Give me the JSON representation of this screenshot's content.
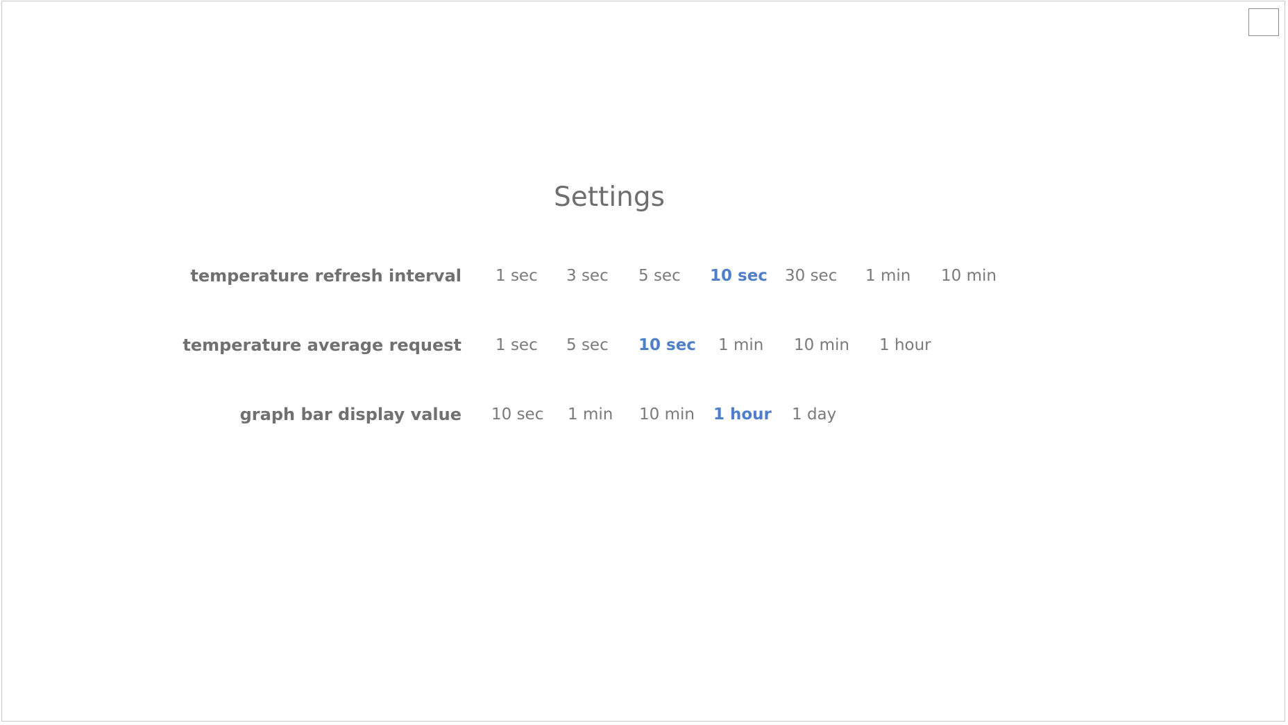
{
  "page": {
    "title": "Settings"
  },
  "colors": {
    "text_muted": "#7a7a7a",
    "label": "#707070",
    "selected": "#4f7fc9"
  },
  "settings": [
    {
      "label": "temperature refresh interval",
      "selected": "10 sec",
      "options": [
        "1 sec",
        "3 sec",
        "5 sec",
        "10 sec",
        "30 sec",
        "1 min",
        "10 min"
      ]
    },
    {
      "label": "temperature average request",
      "selected": "10 sec",
      "options": [
        "1 sec",
        "5 sec",
        "10 sec",
        "1 min",
        "10 min",
        "1 hour"
      ]
    },
    {
      "label": "graph bar display value",
      "selected": "1 hour",
      "options": [
        "10 sec",
        "1 min",
        "10 min",
        "1 hour",
        "1 day"
      ]
    }
  ]
}
